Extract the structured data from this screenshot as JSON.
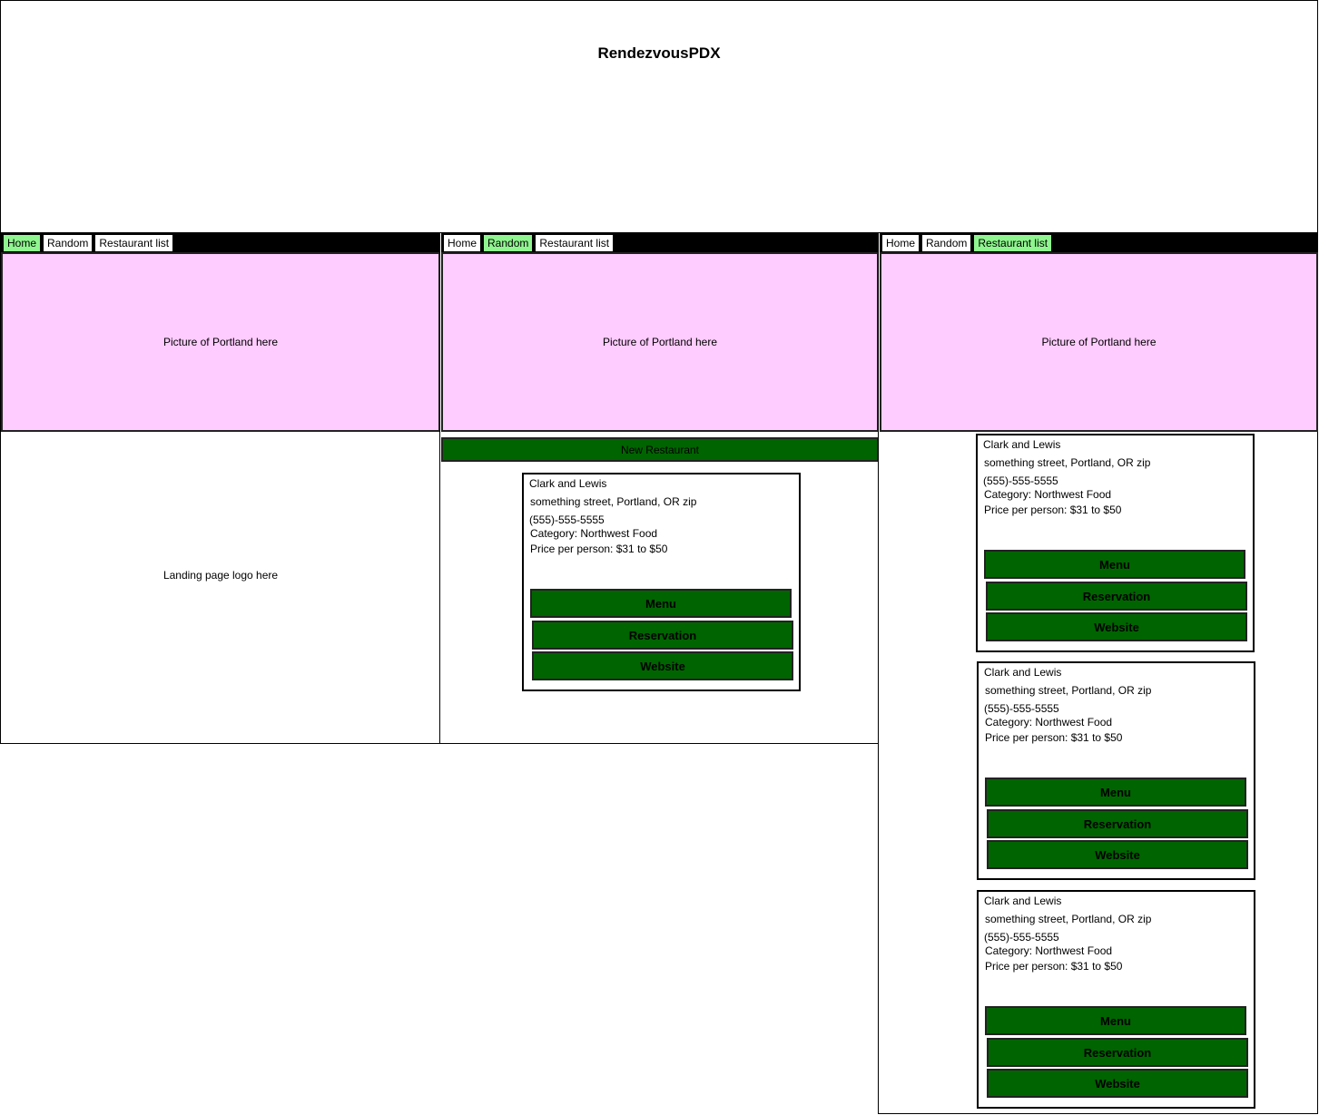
{
  "site": {
    "title": "RendezvousPDX"
  },
  "nav": {
    "home": "Home",
    "random": "Random",
    "restaurant_list": "Restaurant list"
  },
  "hero_placeholder": "Picture of Portland here",
  "landing": {
    "logo_placeholder": "Landing page logo here"
  },
  "random_page": {
    "new_restaurant_label": "New Restaurant"
  },
  "restaurant": {
    "name": "Clark and Lewis",
    "address": "something street, Portland, OR zip",
    "phone": "(555)-555-5555",
    "category": "Category: Northwest Food",
    "price": "Price per person: $31 to $50",
    "menu_label": "Menu",
    "reservation_label": "Reservation",
    "website_label": "Website"
  },
  "colors": {
    "active_tab": "#8ff58f",
    "hero_bg": "#ffccff",
    "button_green": "#006400"
  }
}
